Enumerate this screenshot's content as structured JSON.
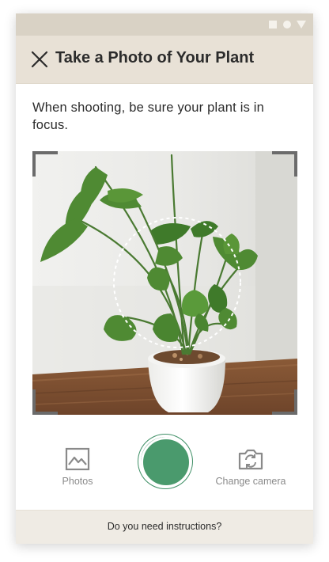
{
  "statusbar": {
    "icons": [
      "square-icon",
      "circle-icon",
      "triangle-icon"
    ]
  },
  "appbar": {
    "close_icon": "close-icon",
    "title": "Take a Photo of Your Plant"
  },
  "main": {
    "instruction": "When shooting, be sure your plant is in focus."
  },
  "camera": {
    "photos_label": "Photos",
    "change_camera_label": "Change camera",
    "shutter_color": "#3f8f66"
  },
  "footer": {
    "instructions_link": "Do you need instructions?"
  },
  "colors": {
    "statusbar": "#d9d2c5",
    "appbar": "#e8e1d6",
    "footer": "#efebe4",
    "accent": "#3f8f66"
  }
}
